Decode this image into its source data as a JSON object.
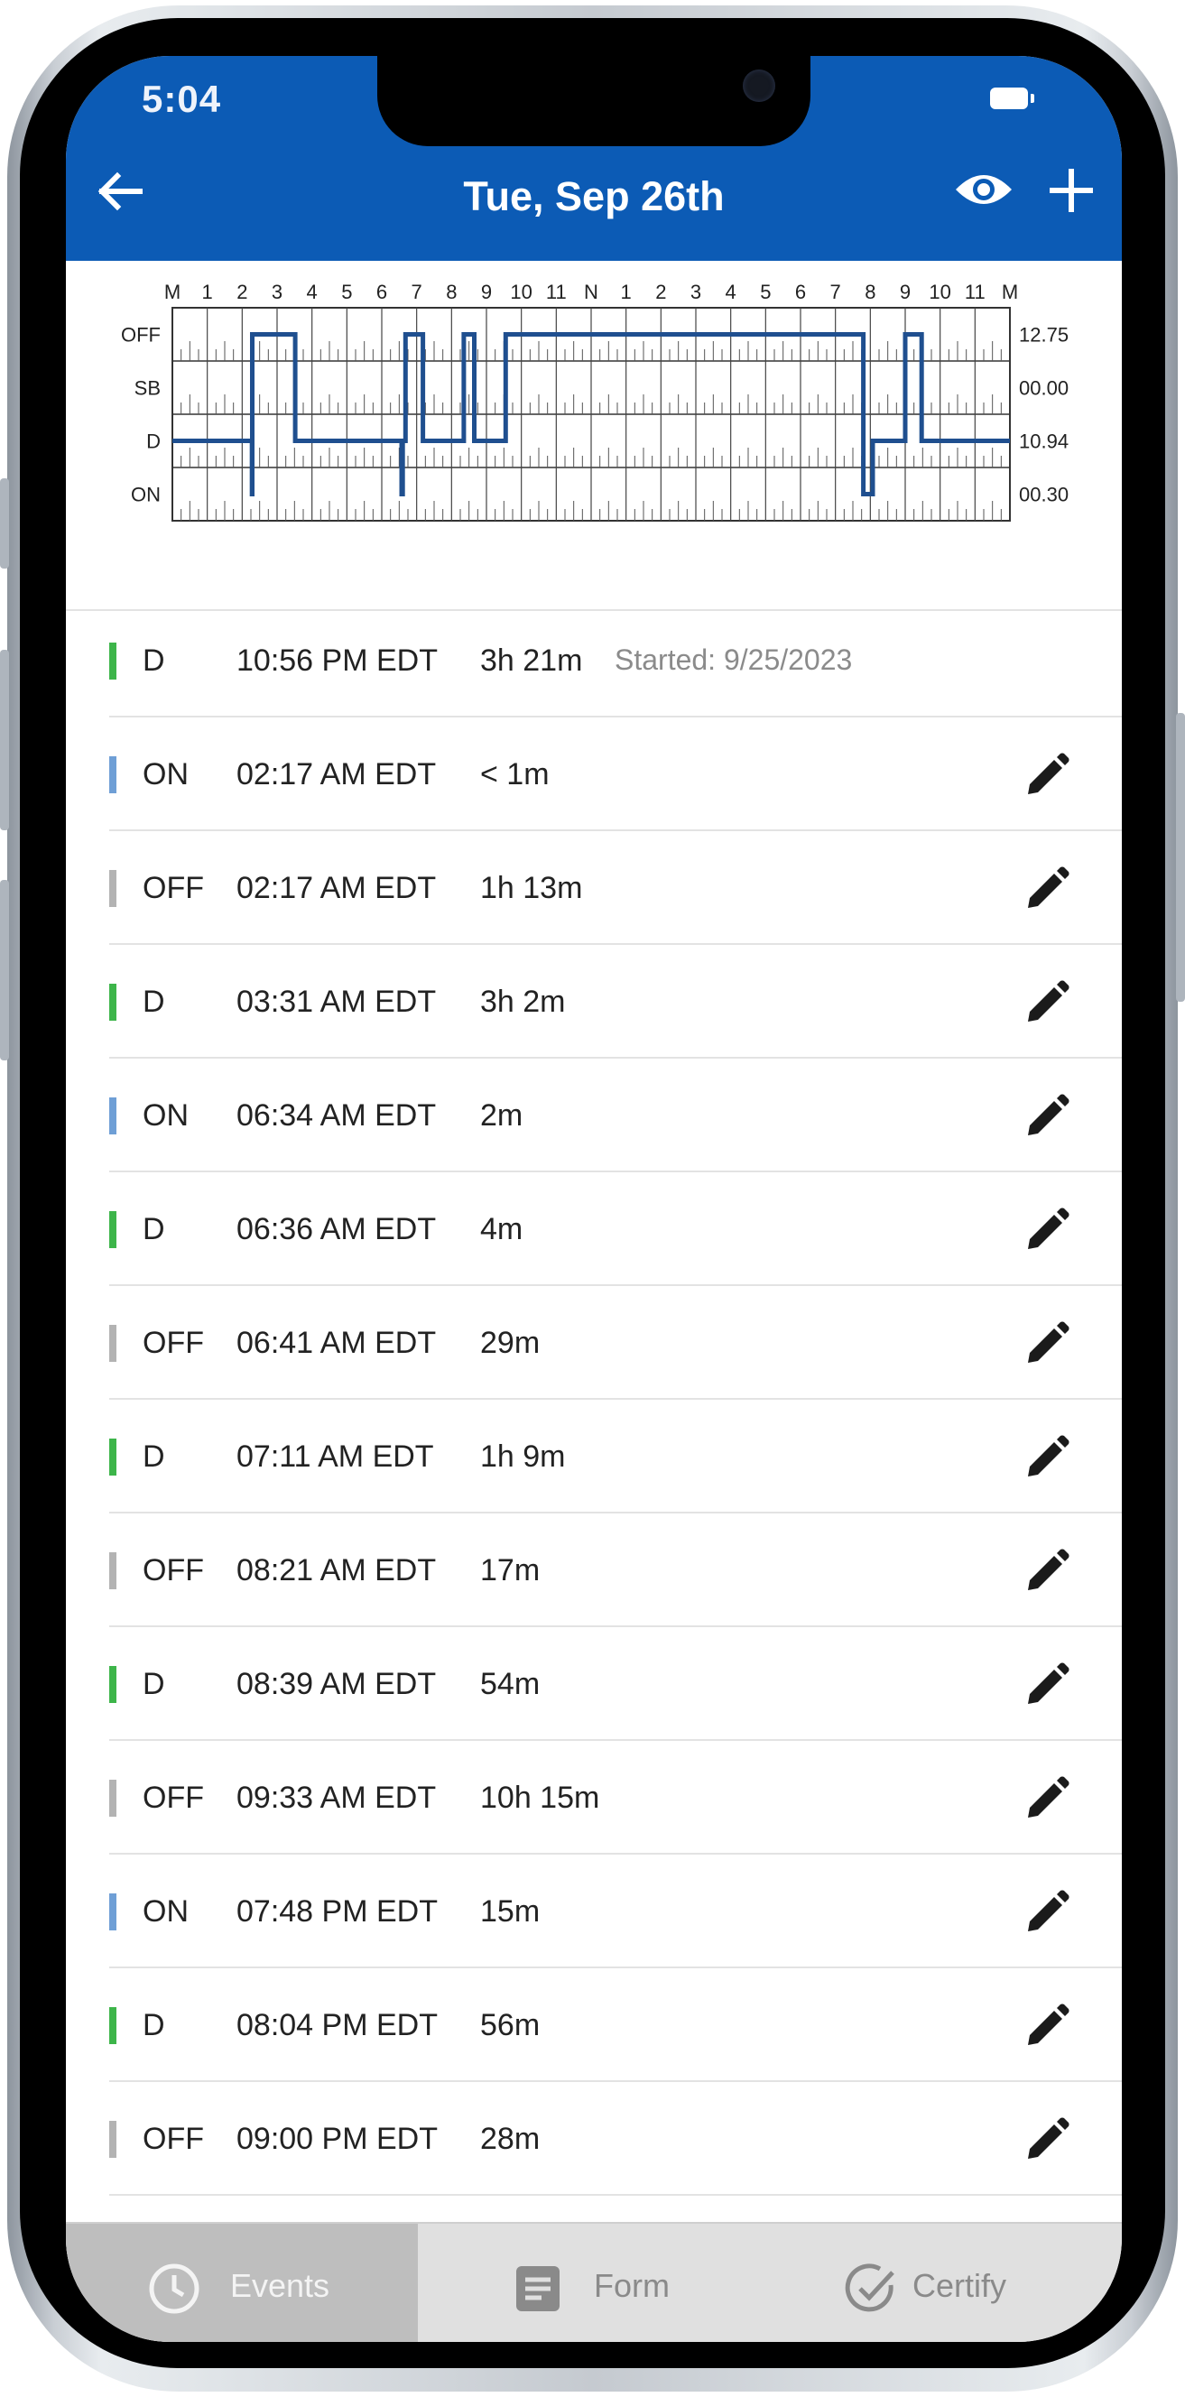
{
  "status_bar": {
    "time": "5:04"
  },
  "header": {
    "title": "Tue, Sep 26th",
    "back_icon": "arrow-left-icon",
    "view_icon": "eye-icon",
    "add_icon": "plus-icon",
    "bar_color": "#0c5bb5"
  },
  "chart_data": {
    "type": "line",
    "x_tick_labels": [
      "M",
      "1",
      "2",
      "3",
      "4",
      "5",
      "6",
      "7",
      "8",
      "9",
      "10",
      "11",
      "N",
      "1",
      "2",
      "3",
      "4",
      "5",
      "6",
      "7",
      "8",
      "9",
      "10",
      "11",
      "M"
    ],
    "y_categories": [
      "OFF",
      "SB",
      "D",
      "ON"
    ],
    "totals": [
      "12.75",
      "00.00",
      "10.94",
      "00.30"
    ],
    "line_color": "#1f4f8f",
    "series": [
      {
        "values_hours": [
          0,
          2.28,
          2.29,
          3.52,
          6.57,
          6.6,
          6.68,
          7.18,
          8.35,
          8.65,
          9.55,
          19.8,
          20.07,
          21.0,
          21.47,
          24
        ],
        "values_status": [
          "D",
          "ON",
          "OFF",
          "D",
          "ON",
          "D",
          "OFF",
          "D",
          "OFF",
          "D",
          "OFF",
          "ON",
          "D",
          "OFF",
          "D",
          "D"
        ]
      }
    ]
  },
  "events": [
    {
      "status": "D",
      "time": "10:56 PM EDT",
      "duration": "3h 21m",
      "note": "Started: 9/25/2023",
      "color": "#3db54a",
      "editable": false
    },
    {
      "status": "ON",
      "time": "02:17 AM EDT",
      "duration": "< 1m",
      "note": "",
      "color": "#6f9fd6",
      "editable": true
    },
    {
      "status": "OFF",
      "time": "02:17 AM EDT",
      "duration": "1h 13m",
      "note": "",
      "color": "#b3b3b3",
      "editable": true
    },
    {
      "status": "D",
      "time": "03:31 AM EDT",
      "duration": "3h 2m",
      "note": "",
      "color": "#3db54a",
      "editable": true
    },
    {
      "status": "ON",
      "time": "06:34 AM EDT",
      "duration": "2m",
      "note": "",
      "color": "#6f9fd6",
      "editable": true
    },
    {
      "status": "D",
      "time": "06:36 AM EDT",
      "duration": "4m",
      "note": "",
      "color": "#3db54a",
      "editable": true
    },
    {
      "status": "OFF",
      "time": "06:41 AM EDT",
      "duration": "29m",
      "note": "",
      "color": "#b3b3b3",
      "editable": true
    },
    {
      "status": "D",
      "time": "07:11 AM EDT",
      "duration": "1h 9m",
      "note": "",
      "color": "#3db54a",
      "editable": true
    },
    {
      "status": "OFF",
      "time": "08:21 AM EDT",
      "duration": "17m",
      "note": "",
      "color": "#b3b3b3",
      "editable": true
    },
    {
      "status": "D",
      "time": "08:39 AM EDT",
      "duration": "54m",
      "note": "",
      "color": "#3db54a",
      "editable": true
    },
    {
      "status": "OFF",
      "time": "09:33 AM EDT",
      "duration": "10h 15m",
      "note": "",
      "color": "#b3b3b3",
      "editable": true
    },
    {
      "status": "ON",
      "time": "07:48 PM EDT",
      "duration": "15m",
      "note": "",
      "color": "#6f9fd6",
      "editable": true
    },
    {
      "status": "D",
      "time": "08:04 PM EDT",
      "duration": "56m",
      "note": "",
      "color": "#3db54a",
      "editable": true
    },
    {
      "status": "OFF",
      "time": "09:00 PM EDT",
      "duration": "28m",
      "note": "",
      "color": "#b3b3b3",
      "editable": true
    }
  ],
  "bottom_nav": {
    "tabs": [
      {
        "label": "Events",
        "icon": "clock-icon",
        "active": true
      },
      {
        "label": "Form",
        "icon": "form-icon",
        "active": false
      },
      {
        "label": "Certify",
        "icon": "check-circle-icon",
        "active": false
      }
    ]
  }
}
